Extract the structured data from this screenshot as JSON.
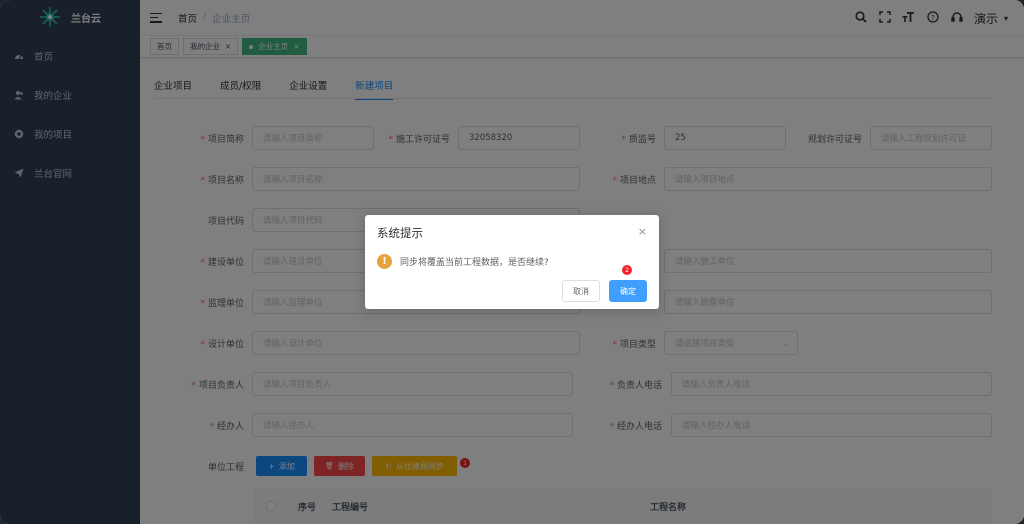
{
  "brand": {
    "name": "兰台云"
  },
  "sidebar": {
    "items": [
      {
        "label": "首页",
        "icon": "dashboard-icon"
      },
      {
        "label": "我的企业",
        "icon": "users-icon"
      },
      {
        "label": "我的项目",
        "icon": "project-icon"
      },
      {
        "label": "兰台官网",
        "icon": "send-icon"
      }
    ]
  },
  "breadcrumb": {
    "home": "首页",
    "sep": "/",
    "current": "企业主页"
  },
  "navbar": {
    "user_name": "演示",
    "user_caret": "▾"
  },
  "tags_view": {
    "tags": [
      {
        "label": "首页"
      },
      {
        "label": "我的企业",
        "close": "×"
      },
      {
        "label": "企业主页",
        "close": "×"
      }
    ]
  },
  "tabs": [
    {
      "label": "企业项目"
    },
    {
      "label": "成员/权限"
    },
    {
      "label": "企业设置"
    },
    {
      "label": "新建项目",
      "active": true
    }
  ],
  "form": {
    "req_mark": "*",
    "project_short": {
      "label": "项目简称",
      "placeholder": "请输入项目简称"
    },
    "permit_no": {
      "label": "施工许可证号",
      "value": "32058320"
    },
    "supervision_no": {
      "label": "质监号",
      "value": "25"
    },
    "planning_permit": {
      "label": "规划许可证号",
      "placeholder": "请输入工程规划许可证"
    },
    "project_name": {
      "label": "项目名称",
      "placeholder": "请输入项目名称"
    },
    "project_site": {
      "label": "项目地点",
      "placeholder": "请输入项目地点"
    },
    "project_code": {
      "label": "项目代码",
      "placeholder": "请输入项目代码"
    },
    "build_unit": {
      "label": "建设单位",
      "placeholder": "请输入建设单位"
    },
    "construct_unit": {
      "placeholder": "请输入施工单位"
    },
    "supervise_unit": {
      "label": "监理单位",
      "placeholder": "请输入监理单位"
    },
    "survey_unit": {
      "placeholder": "请输入勘察单位"
    },
    "design_unit": {
      "label": "设计单位",
      "placeholder": "请输入设计单位"
    },
    "project_type": {
      "label": "项目类型",
      "placeholder": "请选择项目类型"
    },
    "manager": {
      "label": "项目负责人",
      "placeholder": "请输入项目负责人"
    },
    "manager_phone": {
      "label": "负责人电话",
      "placeholder": "请输入负责人电话"
    },
    "handler": {
      "label": "经办人",
      "placeholder": "请输入经办人"
    },
    "handler_phone": {
      "label": "经办人电话",
      "placeholder": "请输入经办人电话"
    },
    "unit_project": {
      "label": "单位工程"
    }
  },
  "toolbar": {
    "add_label": "添加",
    "add_icon": "+",
    "delete_label": "删除",
    "delete_icon": "🗑",
    "sync_label": "从住建局同步",
    "sync_icon": "↻",
    "sync_badge": "1"
  },
  "table": {
    "columns": [
      "序号",
      "工程编号",
      "工程名称"
    ]
  },
  "dialog": {
    "title": "系统提示",
    "close": "×",
    "warn_icon": "!",
    "message": "同步将覆盖当前工程数据，是否继续?",
    "cancel_label": "取消",
    "ok_label": "确定",
    "ok_badge": "2"
  },
  "colors": {
    "sidebar": "#304156",
    "primary": "#409eff",
    "active_tag": "#42b983",
    "danger": "#ff4949",
    "warning": "#ffba00"
  }
}
